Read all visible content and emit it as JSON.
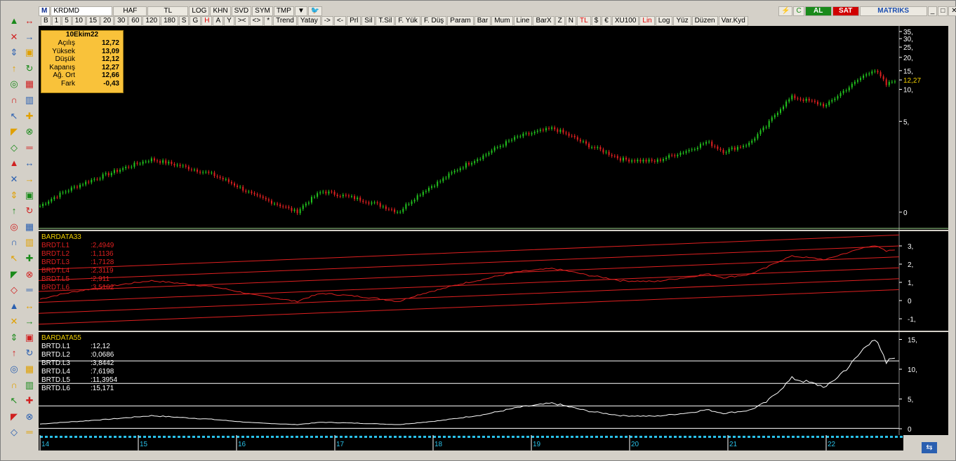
{
  "header": {
    "logo": "M",
    "symbol": "KRDMD",
    "period_haf": "HAF",
    "currency": "TL",
    "log": "LOG",
    "khn": "KHN",
    "svd": "SVD",
    "sym": "SYM",
    "tmp": "TMP",
    "al": "AL",
    "sat": "SAT",
    "brand": "MATRIKS"
  },
  "toolbar2": [
    "B",
    "1",
    "5",
    "10",
    "15",
    "20",
    "30",
    "60",
    "120",
    "180",
    "S",
    "G",
    "H",
    "A",
    "Y",
    "><",
    "<>",
    "*",
    "Trend",
    "Yatay",
    "->",
    "<-",
    "Prl",
    "Sil",
    "T.Sil",
    "F. Yük",
    "F. Düş",
    "Param",
    "Bar",
    "Mum",
    "Line",
    "BarX",
    "Z",
    "N",
    "TL",
    "$",
    "€",
    "XU100",
    "Lin",
    "Log",
    "Yüz",
    "Düzen",
    "Var.Kyd"
  ],
  "infobox": {
    "date": "10Ekim22",
    "rows": [
      {
        "k": "Açılış",
        "v": "12,72"
      },
      {
        "k": "Yüksek",
        "v": "13,09"
      },
      {
        "k": "Düşük",
        "v": "12,12"
      },
      {
        "k": "Kapanış",
        "v": "12,27"
      },
      {
        "k": "Ağ. Ort",
        "v": "12,66"
      },
      {
        "k": "Fark",
        "v": "-0,43"
      }
    ]
  },
  "price_axis": [
    "35,",
    "30,",
    "25,",
    "20,",
    "15,",
    "12,27",
    "10,",
    "5,",
    "0"
  ],
  "last_price": "12,27",
  "panel2": {
    "title": "BARDATA33",
    "lines": [
      {
        "k": "BRDT.L1",
        "v": ":2,4949"
      },
      {
        "k": "BRDT.L2",
        "v": ":1,1136"
      },
      {
        "k": "BRDT.L3",
        "v": ":1,7128"
      },
      {
        "k": "BRDT.L4",
        "v": ":2,3119"
      },
      {
        "k": "BRDT.L5",
        "v": ":2,911"
      },
      {
        "k": "BRDT.L6",
        "v": ":3,5102"
      }
    ],
    "axis": [
      "3,",
      "2,",
      "1,",
      "0",
      "-1,"
    ]
  },
  "panel3": {
    "title": "BARDATA55",
    "lines": [
      {
        "k": "BRTD.L1",
        "v": ":12,12"
      },
      {
        "k": "BRTD.L2",
        "v": ":0,0686"
      },
      {
        "k": "BRTD.L3",
        "v": ":3,8442"
      },
      {
        "k": "BRTD.L4",
        "v": ":7,6198"
      },
      {
        "k": "BRTD.L5",
        "v": ":11,3954"
      },
      {
        "k": "BRTD.L6",
        "v": ":15,171"
      }
    ],
    "axis": [
      "15,",
      "10,",
      "5,",
      "0"
    ]
  },
  "time_axis": [
    "14",
    "15",
    "16",
    "17",
    "18",
    "19",
    "20",
    "21",
    "22"
  ],
  "colors": {
    "up": "#22c41e",
    "down": "#e02020",
    "channel": "#e02020",
    "accent": "#f9c23a"
  }
}
